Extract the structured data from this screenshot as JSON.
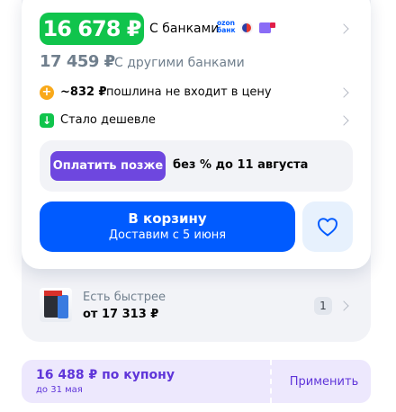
{
  "price": {
    "card_price": "16 678 ₽",
    "card_label": "С банками",
    "ozon_bank_logo": "ozon банк",
    "old_price": "17 459 ₽",
    "old_label": "С другими банками"
  },
  "duty": {
    "amount": "~832 ₽",
    "text": "пошлина не входит в цену",
    "icon": "plus-circle-icon"
  },
  "cheaper": {
    "text": "Стало дешевле",
    "icon": "arrow-down-icon"
  },
  "installment": {
    "button_label": "Оплатить позже",
    "terms": "без % до 11 августа"
  },
  "cart": {
    "label": "В корзину",
    "delivery": "Доставим с 5 июня"
  },
  "favorite": {
    "icon": "heart-icon"
  },
  "faster_offer": {
    "title": "Есть быстрее",
    "price": "от 17 313 ₽",
    "count": "1"
  },
  "coupon": {
    "price": "16 488 ₽ по купону",
    "valid_until": "до 31 мая",
    "apply_label": "Применить"
  },
  "colors": {
    "accent_green": "#10c44c",
    "brand_blue": "#005bff",
    "purple": "#6e47df",
    "coupon_text": "#5f35d9"
  }
}
